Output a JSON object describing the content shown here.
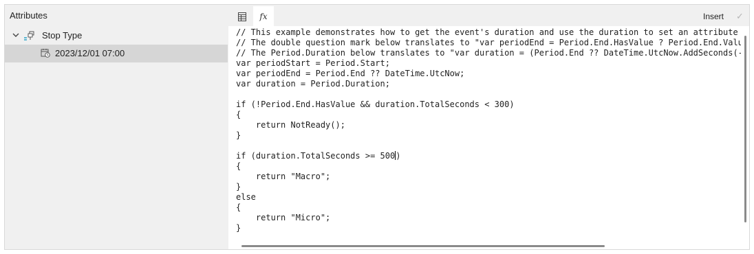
{
  "attributes": {
    "header": "Attributes",
    "tree": {
      "element": {
        "label": "Stop Type",
        "icon": "attribute-template-icon",
        "expander": "chevron-down-icon"
      },
      "value": {
        "label": "2023/12/01 07:00",
        "icon": "calendar-clock-icon"
      }
    }
  },
  "editor": {
    "tabs": [
      {
        "name": "table-icon"
      },
      {
        "name": "fx-icon",
        "label": "fx"
      }
    ],
    "insert_label": "Insert",
    "apply_icon": "checkmark-icon",
    "code_lines": [
      "// This example demonstrates how to get the event's duration and use the duration to set an attribute val",
      "// The double question mark below translates to \"var periodEnd = Period.End.HasValue ? Period.End.Value :",
      "// The Period.Duration below translates to \"var duration = (Period.End ?? DateTime.UtcNow.AddSeconds(-Per",
      "var periodStart = Period.Start;",
      "var periodEnd = Period.End ?? DateTime.UtcNow;",
      "var duration = Period.Duration;",
      "",
      "if (!Period.End.HasValue && duration.TotalSeconds < 300)",
      "{",
      "    return NotReady();",
      "}",
      "",
      "if (duration.TotalSeconds >= 500)",
      "{",
      "    return \"Macro\";",
      "}",
      "else",
      "{",
      "    return \"Micro\";",
      "}"
    ]
  }
}
